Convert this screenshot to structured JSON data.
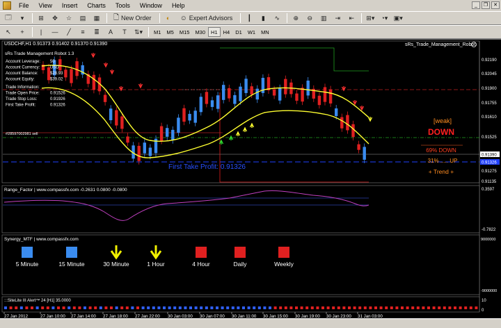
{
  "menu": [
    "File",
    "View",
    "Insert",
    "Charts",
    "Tools",
    "Window",
    "Help"
  ],
  "toolbar": {
    "new_order": "New Order",
    "expert_advisors": "Expert Advisors",
    "timeframes": [
      "M1",
      "M5",
      "M15",
      "M30",
      "H1",
      "H4",
      "D1",
      "W1",
      "MN"
    ],
    "active_timeframe": "H1"
  },
  "chart": {
    "symbol_header": "USDCHF,H1  0.91373 0.91402 0.91370 0.91390",
    "ea_name": "sRs_Trade_Management_Robot",
    "panel_title": "sRs Trade Management Robot 1.3",
    "account": [
      {
        "label": "Account Leverage:",
        "value": "50"
      },
      {
        "label": "Account Currency:",
        "value": "USD"
      },
      {
        "label": "Account Balance:",
        "value": "$28.93"
      },
      {
        "label": "Account Equity:",
        "value": "$39.02"
      }
    ],
    "trade_info_title": "Trade Information:",
    "trade": [
      {
        "label": "Trade Open Price:",
        "value": "0.91526"
      },
      {
        "label": "Trade Stop Loss:",
        "value": "0.91926"
      },
      {
        "label": "First Take Profit:",
        "value": "0.91326"
      }
    ],
    "order_label": "#28597002981 sell",
    "tp_label": "First Take Profit: 0.91326",
    "price_labels": [
      "0.92190",
      "0.92045",
      "0.91900",
      "0.91755",
      "0.91610",
      "0.91525",
      "0.91390",
      "0.91326",
      "0.91275",
      "0.91135"
    ],
    "current_price": "0.91390",
    "tp_price": "0.91326",
    "signal_weak": "[weak]",
    "signal_down": "DOWN",
    "pct_down": "69% DOWN",
    "pct_up": "31% ..... UP",
    "trend": "+  Trend  +"
  },
  "range_factor": {
    "header": "Range_Factor | www.compassfx.com   -0.2631 0.0800 -0.0800",
    "scale_top": "0.3597",
    "scale_bottom": "-0.7822"
  },
  "synergy": {
    "header": "Synergy_MTF | www.compassfx.com",
    "scale_top": "9000000",
    "scale_bottom": "-9000000",
    "items": [
      {
        "label": "5 Minute",
        "kind": "square",
        "color": "#3a8cf0"
      },
      {
        "label": "15 Minute",
        "kind": "square",
        "color": "#3a8cf0"
      },
      {
        "label": "30 Minute",
        "kind": "arrow",
        "color": "#f0f000"
      },
      {
        "label": "1 Hour",
        "kind": "arrow",
        "color": "#f0f000"
      },
      {
        "label": "4 Hour",
        "kind": "square",
        "color": "#e02020"
      },
      {
        "label": "Daily",
        "kind": "square",
        "color": "#e02020"
      },
      {
        "label": "Weekly",
        "kind": "square",
        "color": "#e02020"
      }
    ]
  },
  "sitelite": {
    "header": ":::SiteLite III Alert™ 24 [H1] 35.0000",
    "scale_top": "10",
    "scale_bottom": "0"
  },
  "time_axis": [
    "27 Jan 2012",
    "27 Jan 10:00",
    "27 Jan 14:00",
    "27 Jan 18:00",
    "27 Jan 22:00",
    "30 Jan 03:00",
    "30 Jan 07:00",
    "30 Jan 11:00",
    "30 Jan 15:00",
    "30 Jan 19:00",
    "30 Jan 23:00",
    "31 Jan 03:00"
  ],
  "colors": {
    "bull": "#3a8cf0",
    "bear": "#e02020",
    "band": "#ffff30",
    "signal_orange": "#ff8c20",
    "signal_red": "#ff2020"
  }
}
